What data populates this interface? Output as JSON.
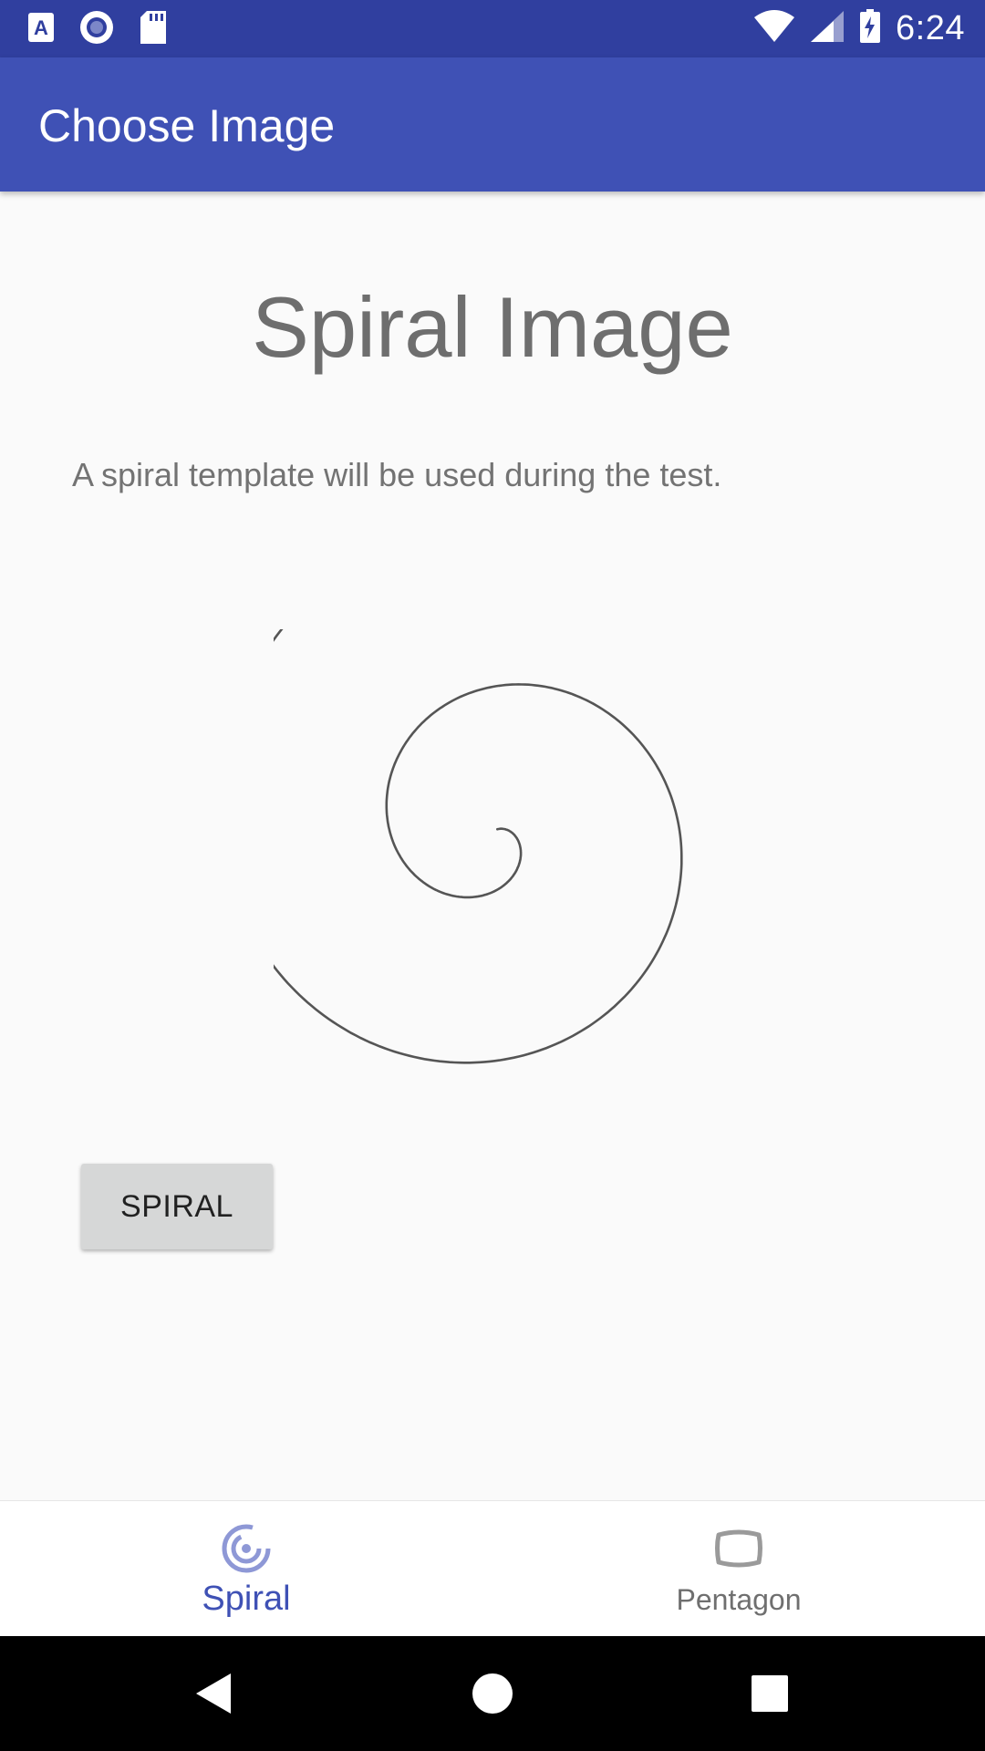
{
  "status_bar": {
    "time": "6:24",
    "left_icons": [
      "a-notification-icon",
      "circle-record-icon",
      "sd-card-icon"
    ],
    "right_icons": [
      "wifi-icon",
      "signal-icon",
      "battery-charging-icon"
    ]
  },
  "app_bar": {
    "title": "Choose Image"
  },
  "main": {
    "heading": "Spiral Image",
    "description": "A spiral template will be used during the test.",
    "image": "spiral-image",
    "button_label": "SPIRAL"
  },
  "bottom_nav": {
    "items": [
      {
        "label": "Spiral",
        "icon": "spiral-icon",
        "active": true
      },
      {
        "label": "Pentagon",
        "icon": "pentagon-icon",
        "active": false
      }
    ]
  },
  "system_nav": {
    "buttons": [
      "back-icon",
      "home-icon",
      "recents-icon"
    ]
  },
  "colors": {
    "status_bar": "#303f9f",
    "app_bar": "#3f51b5",
    "accent": "#3f51b5",
    "background": "#fafafa"
  }
}
